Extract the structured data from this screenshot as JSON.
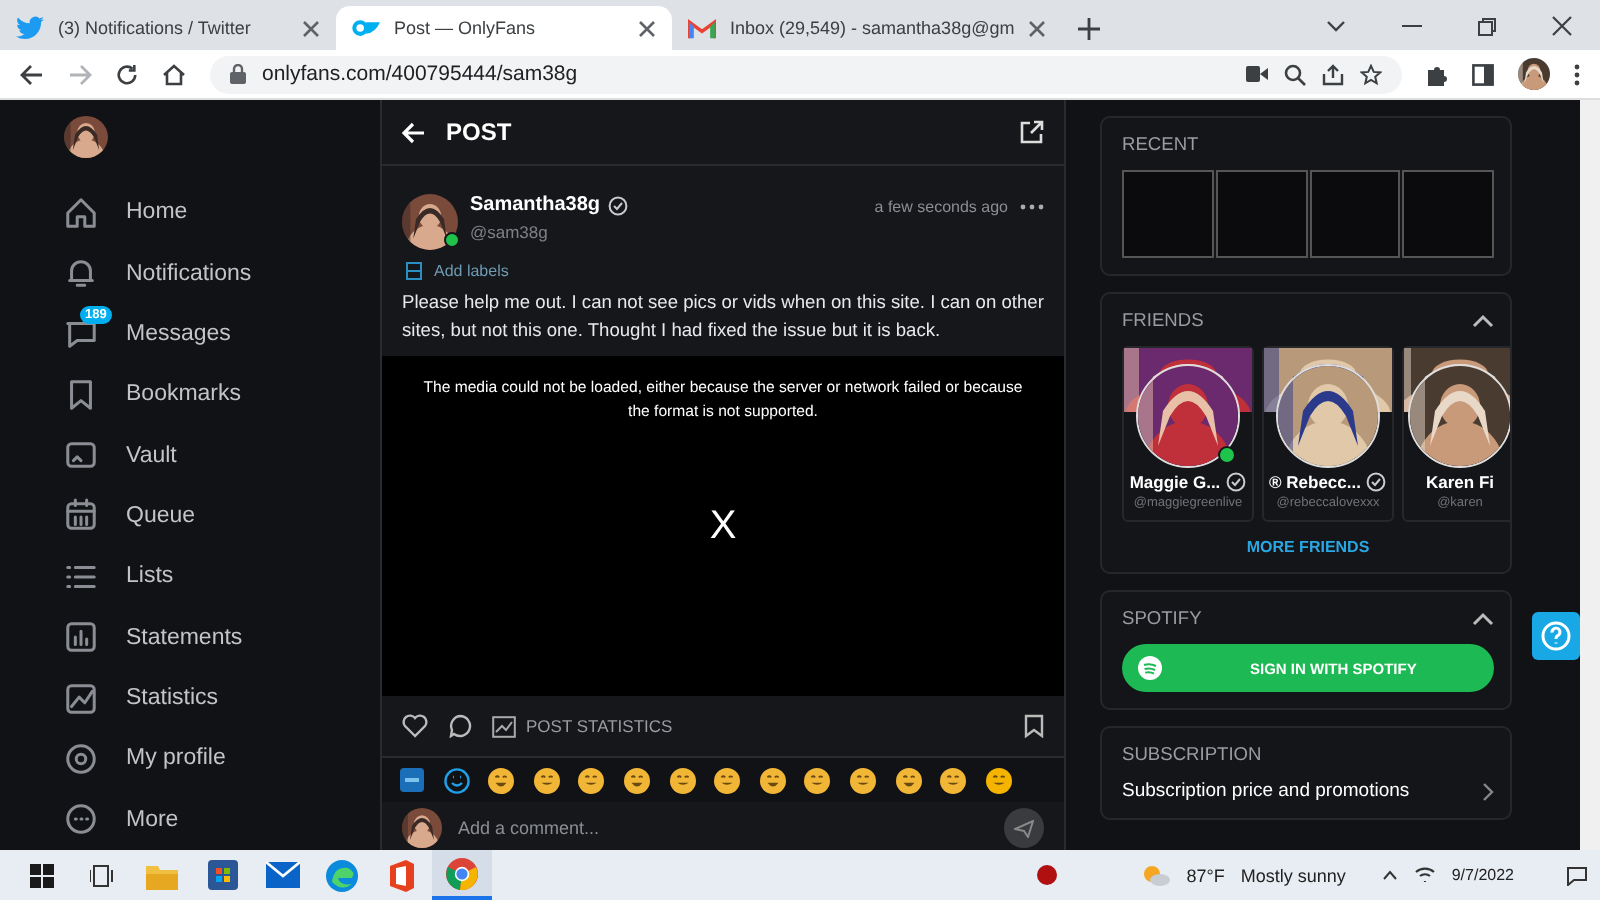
{
  "browser": {
    "tabs": [
      {
        "kind": "twitter",
        "title": "(3) Notifications / Twitter",
        "selected": false
      },
      {
        "kind": "onlyfans",
        "title": "Post — OnlyFans",
        "selected": true
      },
      {
        "kind": "gmail",
        "title": "Inbox (29,549) - samantha38g@gm",
        "selected": false
      }
    ],
    "url": "onlyfans.com/400795444/sam38g"
  },
  "sidebar": {
    "items": [
      {
        "kind": "home",
        "label": "Home"
      },
      {
        "kind": "bell",
        "label": "Notifications"
      },
      {
        "kind": "messages",
        "label": "Messages",
        "badge": "189"
      },
      {
        "kind": "bookmark",
        "label": "Bookmarks"
      },
      {
        "kind": "vault",
        "label": "Vault"
      },
      {
        "kind": "calendar",
        "label": "Queue"
      },
      {
        "kind": "list",
        "label": "Lists"
      },
      {
        "kind": "statements",
        "label": "Statements"
      },
      {
        "kind": "statistics",
        "label": "Statistics"
      },
      {
        "kind": "profile",
        "label": "My profile"
      },
      {
        "kind": "more",
        "label": "More"
      }
    ]
  },
  "post": {
    "header": "POST",
    "author": {
      "name": "Samantha38g",
      "handle": "@sam38g",
      "online": true
    },
    "time": "a few seconds ago",
    "labels_link": "Add labels",
    "text": "Please help me out. I can not see pics or vids when on this site. I can on other sites, but not this one. Thought I had fixed the issue but it is back.",
    "media_error": "The media could not be loaded, either because the server or network failed or because the format is not supported.",
    "media_close": "X",
    "stats_label": "POST STATISTICS",
    "comment_placeholder": "Add a comment..."
  },
  "right": {
    "recent": {
      "title": "RECENT"
    },
    "friends": {
      "title": "FRIENDS",
      "items": [
        {
          "name": "Maggie G...",
          "handle": "@maggiegreenlive",
          "online": true
        },
        {
          "name": "® Rebecc...",
          "handle": "@rebeccalovexxx",
          "online": false
        },
        {
          "name": "Karen Fi",
          "handle": "@karen",
          "online": false
        }
      ],
      "more": "MORE FRIENDS"
    },
    "spotify": {
      "title": "SPOTIFY",
      "button": "SIGN IN WITH SPOTIFY"
    },
    "subscription": {
      "title": "SUBSCRIPTION",
      "item": "Subscription price and promotions"
    }
  },
  "taskbar": {
    "apps": [
      {
        "kind": "explorer",
        "selected": false
      },
      {
        "kind": "store",
        "selected": false
      },
      {
        "kind": "mail",
        "selected": false
      },
      {
        "kind": "edge",
        "selected": false
      },
      {
        "kind": "office",
        "selected": false
      },
      {
        "kind": "chrome",
        "selected": true
      }
    ],
    "weather": {
      "temp": "87°F",
      "condition": "Mostly sunny"
    },
    "date": "9/7/2022"
  }
}
